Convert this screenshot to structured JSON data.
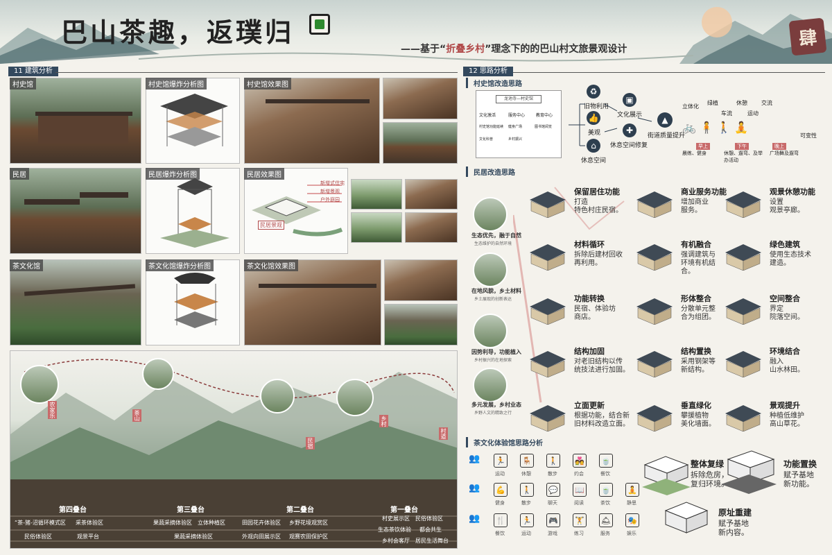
{
  "header": {
    "title": "巴山茶趣，返璞归",
    "subtitle_prefix": "——基于“",
    "subtitle_highlight": "折叠乡村",
    "subtitle_suffix": "”理念下的的巴山村文旅景观设计",
    "seal_text": "肆"
  },
  "sections": {
    "arch": "11  建筑分析",
    "idea": "12  思路分析"
  },
  "arch_panels": {
    "museum": "村史馆",
    "museum_explode": "村史馆爆炸分析图",
    "museum_effect": "村史馆效果图",
    "house": "民居",
    "house_explode": "民居爆炸分析图",
    "house_effect": "民居效果图",
    "house_tags": [
      "新增式住宅",
      "新增景观",
      "户外庭园"
    ],
    "house_tag_extra": "民居景观",
    "tea": "茶文化馆",
    "tea_explode": "茶文化馆爆炸分析图",
    "tea_effect": "茶文化馆效果图"
  },
  "landscape": {
    "tiers": [
      "第四叠台",
      "第三叠台",
      "第二叠台",
      "第一叠台"
    ],
    "zones": [
      [
        "“茶-猪-沼循环模式区",
        "采茶体验区",
        "民俗体验区",
        "观景平台"
      ],
      [
        "果蔬采摘体验区",
        "立体种植区",
        "果蔬采摘体验区"
      ],
      [
        "田园花卉体验区",
        "乡野花境观赏区",
        "外观向田展示区",
        "观赛农田保护区"
      ],
      [
        "村史展示区",
        "民俗体验区",
        "生态茶饮体验",
        "都会共生",
        "乡村会客厅",
        "居民生活舞台"
      ]
    ],
    "bubbles": [
      "“茶-猪-沼”循环模式示范",
      "采茶体验",
      "茶林步道",
      "乡野休憩",
      "田园观赏"
    ],
    "tags": [
      "农家乐",
      "茶山",
      "民宿",
      "乡村",
      "村道"
    ]
  },
  "idea_panel": {
    "museum_title": "村史馆改造思路",
    "org_root": "龙池寺—村史馆",
    "org_children": [
      "文化激活",
      "服务中心",
      "教育中心"
    ],
    "org_leaves": [
      "村史馆功能延续",
      "健身广场",
      "图书馆阅览",
      "文化科普",
      "乡村振兴"
    ],
    "flow_nodes": [
      "旧物利用",
      "美观",
      "休息空间",
      "文化展示",
      "休息空间修复",
      "街道质量提升"
    ],
    "right_labels": [
      "立体化",
      "绿植",
      "休憩",
      "交流",
      "车流",
      "运动",
      "可变性"
    ],
    "time_labels": [
      "早上",
      "下午",
      "晚上"
    ],
    "time_desc": [
      "晨练、健身",
      "休憩、遛弯、及举办活动",
      "广场舞及遛弯"
    ],
    "house_title": "民居改造思路",
    "bubble_titles": [
      "生态优先，融于自然",
      "在地风貌，乡土材料",
      "因势利导，功能植入",
      "多元发展，乡村业态"
    ],
    "bubble_subs": [
      "生态维护的自然环境",
      "乡土展现的创新表达",
      "乡村振兴的在地探索",
      "乡野人文的精致之行"
    ],
    "cells": [
      {
        "t": "保留居住功能",
        "d": "打造\n特色村庄民宿。"
      },
      {
        "t": "商业服务功能",
        "d": "增加商业\n服务。"
      },
      {
        "t": "观景休憩功能",
        "d": "设置\n观景亭廊。"
      },
      {
        "t": "材料循环",
        "d": "拆除后建材回收\n再利用。"
      },
      {
        "t": "有机融合",
        "d": "强调建筑与\n环境有机结\n合。"
      },
      {
        "t": "绿色建筑",
        "d": "使用生态技术\n建造。"
      },
      {
        "t": "功能转换",
        "d": "民宿、体验坊\n商店。"
      },
      {
        "t": "形体整合",
        "d": "分散单元整\n合为组团。"
      },
      {
        "t": "空间整合",
        "d": "界定\n院落空间。"
      },
      {
        "t": "结构加固",
        "d": "对老旧结构以传\n统技法进行加固。"
      },
      {
        "t": "结构置换",
        "d": "采用钢架等\n新结构。"
      },
      {
        "t": "环境结合",
        "d": "融入\n山水林田。"
      },
      {
        "t": "立面更新",
        "d": "根据功能，结合新\n旧材料改造立面。"
      },
      {
        "t": "垂直绿化",
        "d": "攀援植物\n美化墙面。"
      },
      {
        "t": "景观提升",
        "d": "种植低维护\n高山草花。"
      }
    ],
    "tea_title": "茶文化体验馆思路分析",
    "icon_rows": [
      [
        "运动",
        "休憩",
        "散步",
        "约会",
        "餐饮"
      ],
      [
        "健身",
        "散步",
        "聊天",
        "阅读",
        "茶饮",
        "静思"
      ],
      [
        "餐饮",
        "运动",
        "游戏",
        "练习",
        "服务",
        "娱乐"
      ]
    ],
    "right": [
      {
        "t": "整体复绿",
        "d": "拆除危房，\n复归环境。"
      },
      {
        "t": "功能置换",
        "d": "赋予基地\n新功能。"
      },
      {
        "t": "原址重建",
        "d": "赋予基地\n新内容。"
      }
    ]
  },
  "colors": {
    "accent": "#34495e",
    "highlight": "#b04848",
    "seal": "#7a3d3d",
    "flow_red": "#c44a4a"
  }
}
